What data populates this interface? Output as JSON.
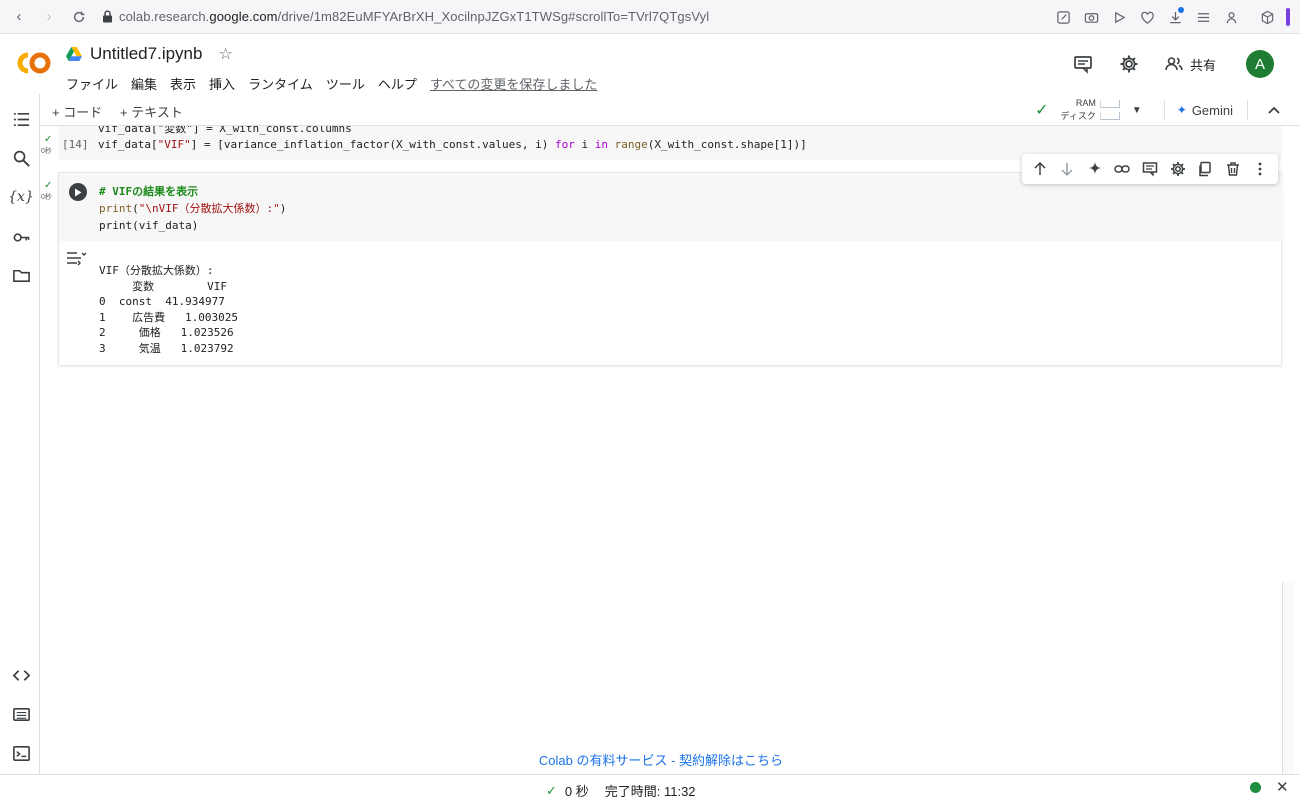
{
  "browser": {
    "url_prefix": "colab.research.",
    "url_host": "google.com",
    "url_path": "/drive/1m82EuMFYArBrXH_XocilnpJZGxT1TWSg#scrollTo=TVrl7QTgsVyl"
  },
  "header": {
    "title": "Untitled7.ipynb",
    "menu": [
      "ファイル",
      "編集",
      "表示",
      "挿入",
      "ランタイム",
      "ツール",
      "ヘルプ"
    ],
    "saved_status": "すべての変更を保存しました",
    "share_label": "共有",
    "avatar_letter": "A"
  },
  "toolbar": {
    "add_code": "+ コード",
    "add_text": "+ テキスト",
    "ram_label": "RAM",
    "disk_label": "ディスク",
    "gemini_label": "Gemini"
  },
  "prev_cell": {
    "line1": "vif_data[\"変数\"] = X_with_const.columns",
    "exec_count": "[14]",
    "line2_a": "vif_data[",
    "line2_b": "\"VIF\"",
    "line2_c": "] = [",
    "line2_d": "variance_inflation_factor",
    "line2_e": "(X_with_const.values, i) ",
    "line2_f": "for",
    "line2_g": " i ",
    "line2_h": "in",
    "line2_i": " ",
    "line2_j": "range",
    "line2_k": "(X_with_const.shape[1])]",
    "time_label": "0秒"
  },
  "current_cell": {
    "comment": "# VIFの結果を表示",
    "print1_fn": "print",
    "print1_arg": "\"\\nVIF（分散拡大係数）:\"",
    "print1_close": ")",
    "print2": "print(vif_data)",
    "time_label": "0秒",
    "output": [
      "VIF（分散拡大係数）:",
      "     変数        VIF",
      "0  const  41.934977",
      "1    広告費   1.003025",
      "2     価格   1.023526",
      "3     気温   1.023792"
    ]
  },
  "promo": {
    "text": "Colab の有料サービス - 契約解除はこちら"
  },
  "statusbar": {
    "duration": "0 秒",
    "completed": "完了時間: 11:32"
  }
}
